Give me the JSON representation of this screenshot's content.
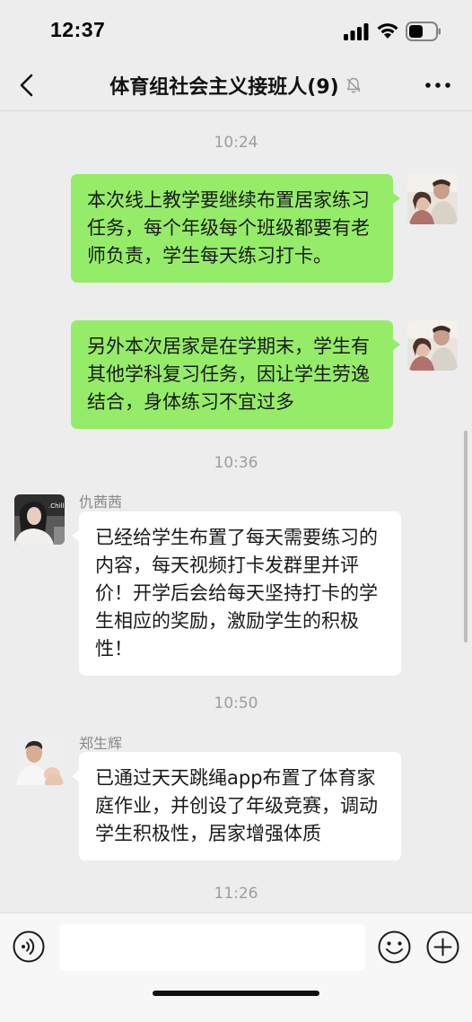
{
  "status_bar": {
    "time": "12:37"
  },
  "header": {
    "title": "体育组社会主义接班人(9)"
  },
  "messages": [
    {
      "kind": "time",
      "text": "10:24"
    },
    {
      "kind": "msg",
      "side": "me",
      "text": "本次线上教学要继续布置居家练习任务，每个年级每个班级都要有老师负责，学生每天练习打卡。"
    },
    {
      "kind": "msg",
      "side": "me",
      "text": "另外本次居家是在学期末，学生有其他学科复习任务，因让学生劳逸结合，身体练习不宜过多"
    },
    {
      "kind": "time",
      "text": "10:36"
    },
    {
      "kind": "msg",
      "side": "other",
      "sender": "仇茜茜",
      "avatar_label": ".Chill",
      "text": "已经给学生布置了每天需要练习的内容，每天视频打卡发群里并评价！开学后会给每天坚持打卡的学生相应的奖励，激励学生的积极性！"
    },
    {
      "kind": "time",
      "text": "10:50"
    },
    {
      "kind": "msg",
      "side": "other",
      "sender": "郑生辉",
      "text": "已通过天天跳绳app布置了体育家庭作业，并创设了年级竞赛，调动学生积极性，居家增强体质"
    },
    {
      "kind": "time",
      "text": "11:26"
    }
  ],
  "input_bar": {
    "value": "",
    "placeholder": ""
  },
  "icons": {
    "back": "chevron-left-icon",
    "mute": "bell-slash-icon",
    "more": "more-dots-icon",
    "voice": "voice-icon",
    "emoji": "emoji-icon",
    "plus": "plus-icon"
  },
  "colors": {
    "my_bubble": "#95ec69",
    "other_bubble": "#ffffff",
    "background": "#ededed"
  }
}
